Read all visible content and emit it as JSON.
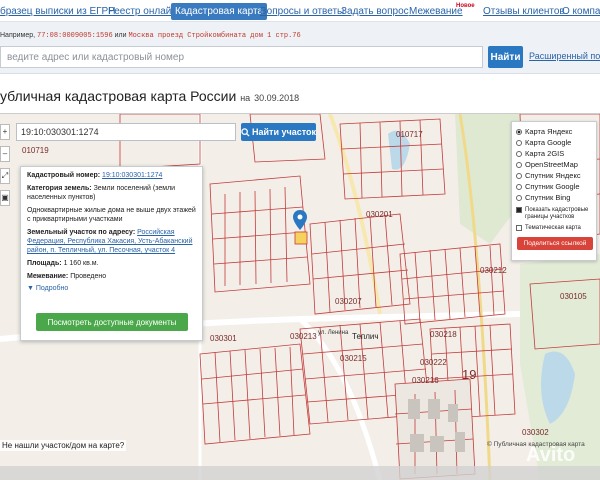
{
  "nav": {
    "items": [
      {
        "label": "бразец выписки из ЕГРН",
        "active": false
      },
      {
        "label": "Реестр онлайн",
        "active": false
      },
      {
        "label": "Кадастровая карта",
        "active": true
      },
      {
        "label": "Вопросы и ответы",
        "active": false
      },
      {
        "label": "Задать вопрос",
        "active": false
      },
      {
        "label": "Межевание",
        "active": false
      },
      {
        "label": "Отзывы клиентов",
        "active": false
      },
      {
        "label": "О компа",
        "active": false
      }
    ],
    "badge": "Новое"
  },
  "search": {
    "example_prefix": "Например,",
    "example_code": "77:08:0009005:1596",
    "example_or": "или",
    "example_address": "Москва проезд Стройкомбината дом 1 стр.76",
    "placeholder": "ведите адрес или кадастровый номер",
    "button": "Найти",
    "advanced_link": "Расширенный поиск"
  },
  "title": {
    "text": "убличная кадастровая карта России",
    "date_prefix": "на",
    "date": "30.09.2018"
  },
  "map": {
    "search_value": "19:10:030301:1274",
    "search_button": "Найти участок",
    "tools": [
      "+",
      "–",
      "⤢",
      "▣"
    ],
    "info": {
      "cad_label": "Кадастровый номер:",
      "cad_value": "19:10:030301:1274",
      "category_label": "Категория земель:",
      "category_value": "Земли поселений (земли населенных пунктов)",
      "use_text": "Одноквартирные жилые дома не выше двух этажей с приквартирными участками",
      "address_label": "Земельный участок по адресу:",
      "address_value": "Российская Федерация, Республика Хакасия, Усть-Абаканский район, п. Тепличный, ул. Песочная, участок 4",
      "area_label": "Площадь:",
      "area_value": "1 160 кв.м.",
      "survey_label": "Межевание:",
      "survey_value": "Проведено",
      "more": "Подробно",
      "docs_button": "Посмотреть доступные документы"
    },
    "layers": {
      "options": [
        "Карта Яндекс",
        "Карта Google",
        "Карта 2GIS",
        "OpenStreetMap",
        "Спутник Яндекс",
        "Спутник Google",
        "Спутник Bing"
      ],
      "selected": 0,
      "checks": [
        {
          "label": "Показать кадастровые границы участков",
          "checked": true
        },
        {
          "label": "Тематическая карта",
          "checked": false
        }
      ],
      "share_button": "Поделиться ссылкой"
    },
    "labels": [
      {
        "text": "010717"
      },
      {
        "text": "010719"
      },
      {
        "text": "030201"
      },
      {
        "text": "030212"
      },
      {
        "text": "030207"
      },
      {
        "text": "030213"
      },
      {
        "text": "030215"
      },
      {
        "text": "030105"
      },
      {
        "text": "030301"
      },
      {
        "text": "030302"
      },
      {
        "text": "19"
      },
      {
        "text": "Теплич"
      },
      {
        "text": "030218"
      },
      {
        "text": "030216"
      },
      {
        "text": "030222"
      }
    ],
    "street": "ул. Ленина",
    "not_found": "Не нашли участок/дом на карте?",
    "copyright": "© Публичная кадастровая карта",
    "watermark": "Avito"
  }
}
